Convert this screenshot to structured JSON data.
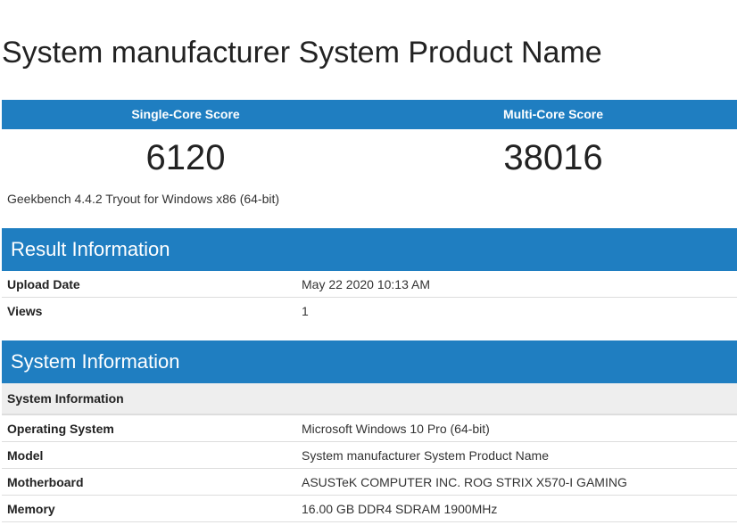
{
  "page": {
    "title": "System manufacturer System Product Name"
  },
  "scores": {
    "single_core_label": "Single-Core Score",
    "multi_core_label": "Multi-Core Score",
    "single_core_value": "6120",
    "multi_core_value": "38016"
  },
  "benchmark": {
    "version": "Geekbench 4.4.2 Tryout for Windows x86 (64-bit)"
  },
  "result_information": {
    "heading": "Result Information",
    "rows": [
      {
        "label": "Upload Date",
        "value": "May 22 2020 10:13 AM"
      },
      {
        "label": "Views",
        "value": "1"
      }
    ]
  },
  "system_information": {
    "heading": "System Information",
    "subheading": "System Information",
    "rows": [
      {
        "label": "Operating System",
        "value": "Microsoft Windows 10 Pro (64-bit)"
      },
      {
        "label": "Model",
        "value": "System manufacturer System Product Name"
      },
      {
        "label": "Motherboard",
        "value": "ASUSTeK COMPUTER INC. ROG STRIX X570-I GAMING"
      },
      {
        "label": "Memory",
        "value": "16.00 GB DDR4 SDRAM 1900MHz"
      }
    ]
  },
  "colors": {
    "header_blue": "#1f7ec1",
    "subheader_gray": "#eeeeee"
  }
}
